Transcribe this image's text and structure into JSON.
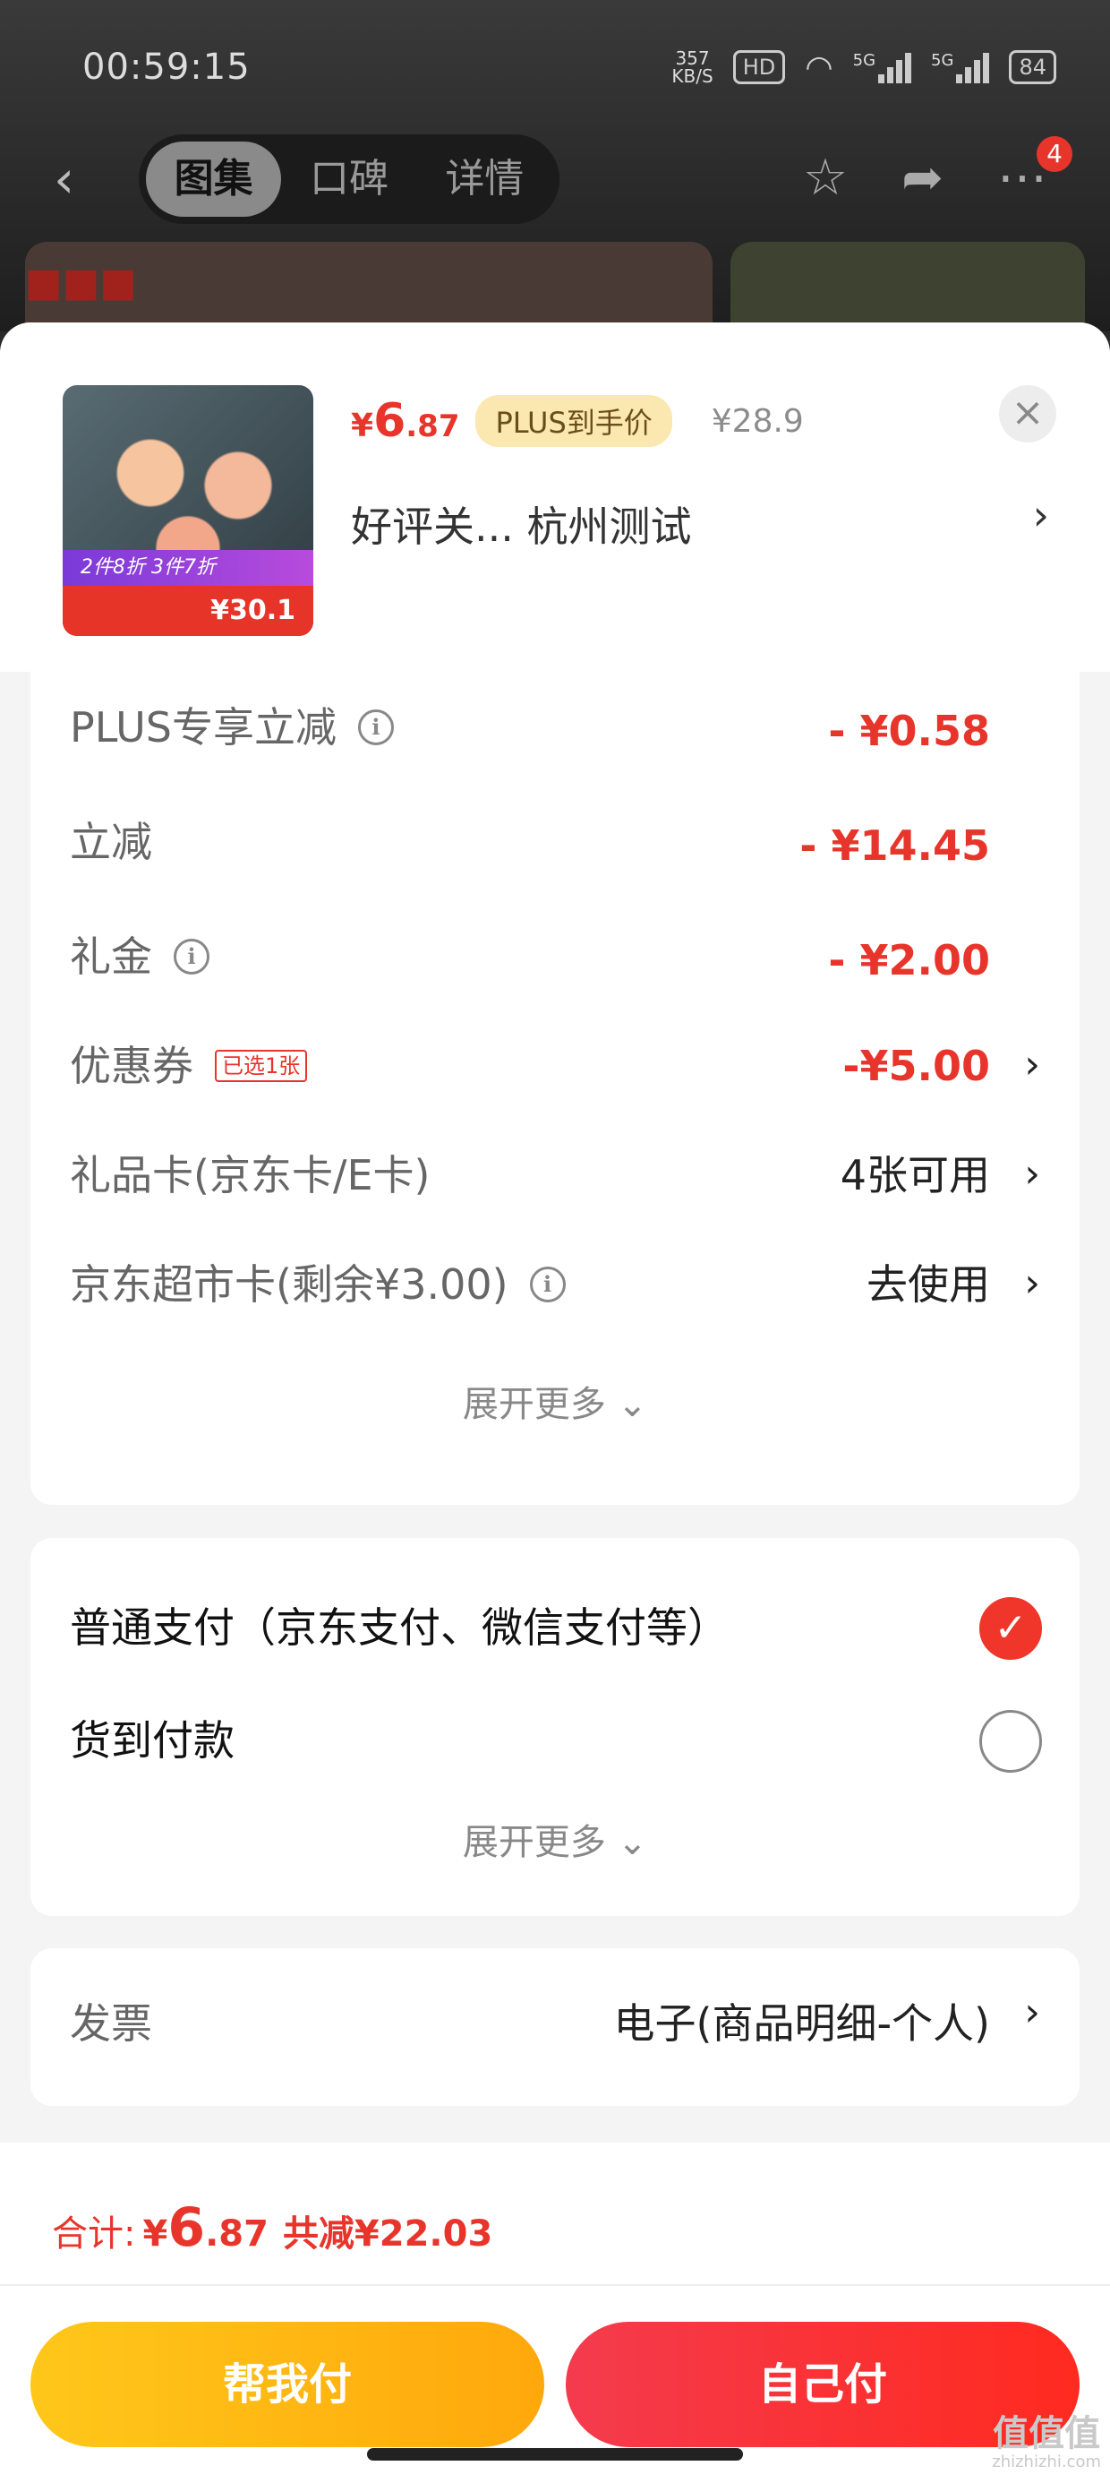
{
  "status_bar": {
    "time": "00:59:15",
    "net_speed_value": "357",
    "net_speed_unit": "KB/S",
    "hd": "HD",
    "sim1": "5G",
    "sim2": "5G",
    "battery": "84"
  },
  "nav": {
    "tabs": [
      "图集",
      "口碑",
      "详情"
    ],
    "active_tab": "图集",
    "badge_count": "4"
  },
  "product": {
    "price_symbol": "¥",
    "price_int": "6",
    "price_dec": ".87",
    "plus_tag": "PLUS到手价",
    "original_price": "¥28.9",
    "name": "好评关... 杭州测试",
    "image_promo_top": "2件8折 3件7折",
    "image_promo_price": "¥30.1"
  },
  "discounts": {
    "rows": [
      {
        "label": "PLUS专享立减",
        "value": "- ¥0.58"
      },
      {
        "label": "立减",
        "value": "- ¥14.45"
      },
      {
        "label": "礼金",
        "value": "- ¥2.00"
      }
    ],
    "coupon": {
      "label": "优惠券",
      "tag": "已选1张",
      "value": "-¥5.00"
    },
    "gift_card": {
      "label": "礼品卡(京东卡/E卡)",
      "value": "4张可用"
    },
    "supermarket_card": {
      "label": "京东超市卡(剩余¥3.00)",
      "value": "去使用"
    },
    "expand_label": "展开更多"
  },
  "payment": {
    "options": [
      {
        "label": "普通支付（京东支付、微信支付等）",
        "checked": true
      },
      {
        "label": "货到付款",
        "checked": false
      }
    ],
    "expand_label": "展开更多"
  },
  "invoice": {
    "label": "发票",
    "value": "电子(商品明细-个人)"
  },
  "footer": {
    "total_label": "合计:",
    "total_symbol": "¥",
    "total_int": "6",
    "total_dec": ".87",
    "saved": "共减¥22.03",
    "help_pay": "帮我付",
    "self_pay": "自己付"
  },
  "watermark": {
    "text": "值值值",
    "url": "zhizhizhi.com"
  },
  "colors": {
    "accent_red": "#e8352b",
    "plus_gold": "#fbe7b0",
    "help_btn": "#ffb511",
    "self_btn": "#f8322f"
  }
}
